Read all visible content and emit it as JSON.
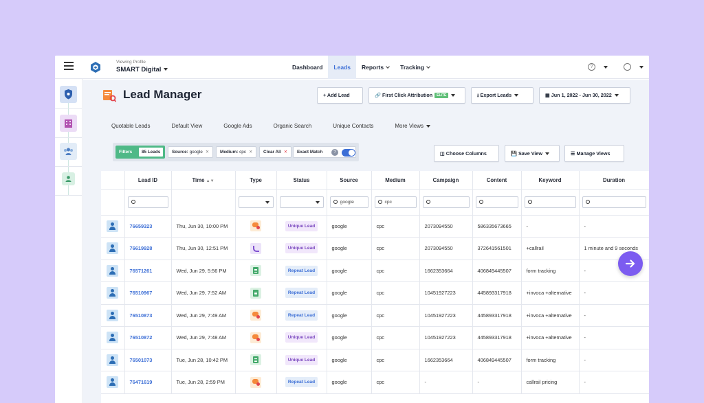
{
  "header": {
    "viewing_label": "Viewing Profile",
    "profile_name": "SMART Digital",
    "nav": [
      {
        "label": "Dashboard",
        "active": false,
        "has_menu": false
      },
      {
        "label": "Leads",
        "active": true,
        "has_menu": false
      },
      {
        "label": "Reports",
        "active": false,
        "has_menu": true
      },
      {
        "label": "Tracking",
        "active": false,
        "has_menu": true
      }
    ],
    "help_icon": "?"
  },
  "page": {
    "title": "Lead Manager",
    "add_lead": "+ Add Lead",
    "attribution": "First Click Attribution",
    "elite_badge": "ELITE",
    "export": "Export Leads",
    "date_range": "Jun 1, 2022 - Jun 30, 2022"
  },
  "views": [
    "Quotable Leads",
    "Default View",
    "Google Ads",
    "Organic Search",
    "Unique Contacts",
    "More Views"
  ],
  "filters": {
    "label": "Filters",
    "count": "85 Leads",
    "source_key": "Source:",
    "source_value": "google",
    "medium_key": "Medium:",
    "medium_value": "cpc",
    "clear_all": "Clear All",
    "exact_match": "Exact Match",
    "help": "?",
    "exact_match_on": true
  },
  "table_actions": {
    "choose_columns": "Choose Columns",
    "save_view": "Save View",
    "manage_views": "Manage Views"
  },
  "columns": [
    "Lead ID",
    "Time",
    "Type",
    "Status",
    "Source",
    "Medium",
    "Campaign",
    "Content",
    "Keyword",
    "Duration"
  ],
  "column_filters": {
    "source": "google",
    "medium": "cpc"
  },
  "rows": [
    {
      "id": "76659323",
      "time": "Thu, Jun 30, 10:00 PM",
      "type": "chat",
      "status": "Unique Lead",
      "source": "google",
      "medium": "cpc",
      "campaign": "2073094550",
      "content": "586335673665",
      "keyword": "-",
      "duration": "-"
    },
    {
      "id": "76619928",
      "time": "Thu, Jun 30, 12:51 PM",
      "type": "call",
      "status": "Unique Lead",
      "source": "google",
      "medium": "cpc",
      "campaign": "2073094550",
      "content": "372641561501",
      "keyword": "+callrail",
      "duration": "1 minute and 9 seconds"
    },
    {
      "id": "76571261",
      "time": "Wed, Jun 29, 5:56 PM",
      "type": "form",
      "status": "Repeat Lead",
      "source": "google",
      "medium": "cpc",
      "campaign": "1662353664",
      "content": "406849445507",
      "keyword": "form tracking",
      "duration": "-"
    },
    {
      "id": "76510967",
      "time": "Wed, Jun 29, 7:52 AM",
      "type": "form",
      "status": "Repeat Lead",
      "source": "google",
      "medium": "cpc",
      "campaign": "10451927223",
      "content": "445893317918",
      "keyword": "+invoca +alternative",
      "duration": "-"
    },
    {
      "id": "76510873",
      "time": "Wed, Jun 29, 7:49 AM",
      "type": "chat",
      "status": "Repeat Lead",
      "source": "google",
      "medium": "cpc",
      "campaign": "10451927223",
      "content": "445893317918",
      "keyword": "+invoca +alternative",
      "duration": "-"
    },
    {
      "id": "76510872",
      "time": "Wed, Jun 29, 7:48 AM",
      "type": "chat",
      "status": "Unique Lead",
      "source": "google",
      "medium": "cpc",
      "campaign": "10451927223",
      "content": "445893317918",
      "keyword": "+invoca +alternative",
      "duration": "-"
    },
    {
      "id": "76501073",
      "time": "Tue, Jun 28, 10:42 PM",
      "type": "form",
      "status": "Unique Lead",
      "source": "google",
      "medium": "cpc",
      "campaign": "1662353664",
      "content": "406849445507",
      "keyword": "form tracking",
      "duration": "-"
    },
    {
      "id": "76471619",
      "time": "Tue, Jun 28, 2:59 PM",
      "type": "chat",
      "status": "Repeat Lead",
      "source": "google",
      "medium": "cpc",
      "campaign": "-",
      "content": "-",
      "keyword": "callrail pricing",
      "duration": "-"
    }
  ],
  "colors": {
    "background": "#d6cbfa",
    "accent": "#3d6fd6",
    "filters_green": "#4fb987",
    "fab": "#7c5cf0"
  }
}
